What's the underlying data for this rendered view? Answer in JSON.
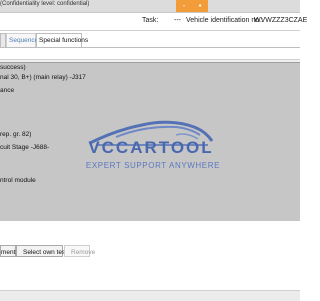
{
  "window": {
    "confidential_text": "(Confidentiality level: confidential)",
    "controls": [
      "-",
      "▪"
    ]
  },
  "infobar": {
    "task_label": "Task:",
    "task_value": "---",
    "vin_label": "Vehicle identification no.:",
    "vin_value": "WVWZZZ3CZAE"
  },
  "tabs": {
    "first_partial": "",
    "sequence": "Sequence",
    "special_functions": "Special functions"
  },
  "list": {
    "items": [
      "success)",
      "nal 30, B+) (main relay) -J317",
      "ance",
      "rep. gr. 82)",
      "cuit Stage -J688-",
      "ntrol module"
    ]
  },
  "watermark": {
    "title": "VCCARTOOL",
    "tagline": "EXPERT SUPPORT ANYWHERE"
  },
  "buttons": {
    "documents": "ments",
    "select_own_test": "Select own test...",
    "remove": "Remove"
  }
}
